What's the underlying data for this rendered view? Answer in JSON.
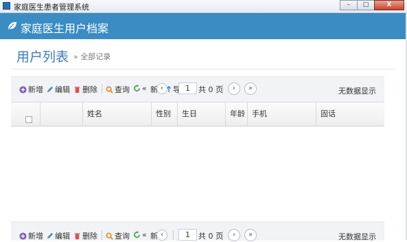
{
  "window": {
    "title": "家庭医生患者管理系统",
    "min": "–",
    "max": "□",
    "close": "X"
  },
  "header": {
    "title": "家庭医生用户档案"
  },
  "page": {
    "title": "用户列表",
    "breadcrumb": "» 全部记录"
  },
  "toolbar": {
    "add": "新增",
    "edit": "编辑",
    "delete": "删除",
    "search": "查询",
    "refresh_partial": "新",
    "export_partial": "导",
    "page_value": "1",
    "total_pages": "共 0 页",
    "empty_text": "无数据显示",
    "prev_glyph": "‹",
    "next_glyph": "›",
    "last_glyph": "»",
    "first_glyph": "«"
  },
  "table": {
    "columns": [
      "姓名",
      "性别",
      "生日",
      "年龄",
      "手机",
      "固话"
    ],
    "rows": []
  },
  "colors": {
    "header_bg": "#3a8cc3",
    "title_blue": "#3a7cb6",
    "toolbar_bg": "#f1f3f6"
  }
}
